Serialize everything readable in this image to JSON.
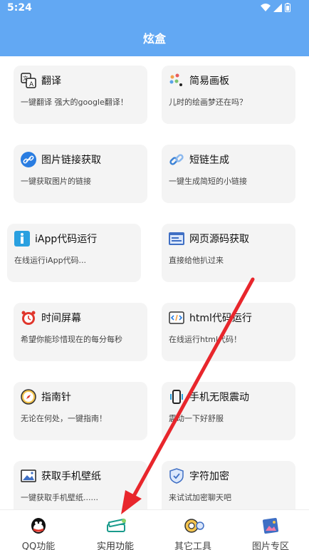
{
  "status": {
    "time": "5:24"
  },
  "app": {
    "title": "炫盒"
  },
  "cards": [
    {
      "title": "翻译",
      "subtitle": "一键翻译 强大的google翻译！",
      "icon": "translate-icon"
    },
    {
      "title": "简易画板",
      "subtitle": "儿时的绘画梦还在吗？",
      "icon": "palette-icon"
    },
    {
      "title": "图片链接获取",
      "subtitle": "一键获取图片的链接",
      "icon": "link-icon"
    },
    {
      "title": "短链生成",
      "subtitle": "一键生成简短的小链接",
      "icon": "chain-icon"
    },
    {
      "title": "iApp代码运行",
      "subtitle": "在线运行iApp代码...",
      "icon": "iapp-icon"
    },
    {
      "title": "网页源码获取",
      "subtitle": "直接给他扒过来",
      "icon": "web-source-icon"
    },
    {
      "title": "时间屏幕",
      "subtitle": "希望你能珍惜现在的每分每秒",
      "icon": "clock-icon"
    },
    {
      "title": "html代码运行",
      "subtitle": "在线运行html代码！",
      "icon": "code-icon"
    },
    {
      "title": "指南针",
      "subtitle": "无论在何处，一键指南！",
      "icon": "compass-icon"
    },
    {
      "title": "手机无限震动",
      "subtitle": "震动一下好舒服",
      "icon": "vibrate-icon"
    },
    {
      "title": "获取手机壁纸",
      "subtitle": "一键获取手机壁纸......",
      "icon": "wallpaper-icon"
    },
    {
      "title": "字符加密",
      "subtitle": "来试试加密聊天吧",
      "icon": "shield-icon"
    }
  ],
  "tabs": [
    {
      "label": "QQ功能",
      "icon": "qq-icon"
    },
    {
      "label": "实用功能",
      "icon": "tools-icon",
      "active": true
    },
    {
      "label": "其它工具",
      "icon": "gear-icon"
    },
    {
      "label": "图片专区",
      "icon": "picture-icon"
    }
  ],
  "colors": {
    "header": "#62a8f3",
    "card": "#f4f4f4",
    "arrow": "#e8262c"
  }
}
